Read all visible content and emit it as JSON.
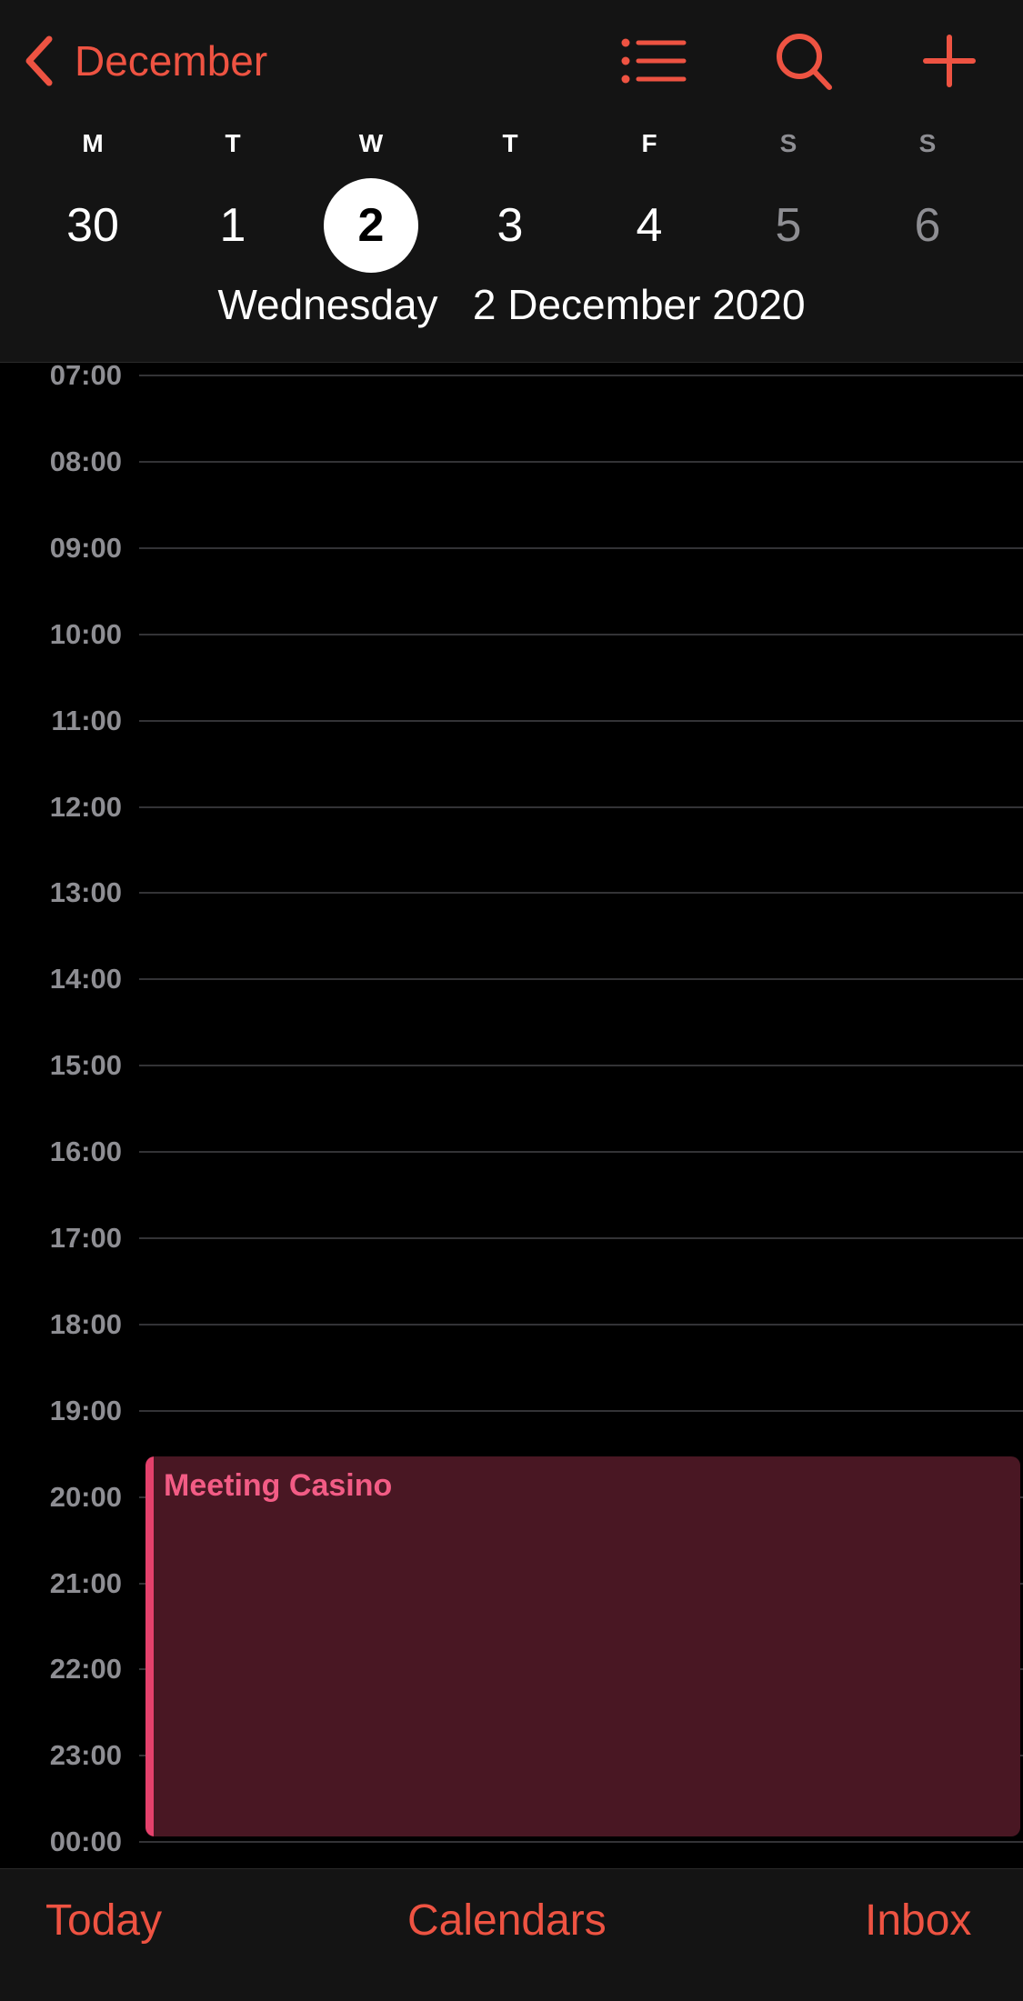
{
  "header": {
    "back_label": "December",
    "icons": {
      "back": "chevron-left-icon",
      "list": "list-icon",
      "search": "search-icon",
      "add": "plus-icon"
    }
  },
  "week": {
    "days": [
      {
        "dow": "M",
        "num": "30"
      },
      {
        "dow": "T",
        "num": "1"
      },
      {
        "dow": "W",
        "num": "2"
      },
      {
        "dow": "T",
        "num": "3"
      },
      {
        "dow": "F",
        "num": "4"
      },
      {
        "dow": "S",
        "num": "5"
      },
      {
        "dow": "S",
        "num": "6"
      }
    ],
    "selected_date": "Wednesday   2 December 2020"
  },
  "timeline": {
    "hours": [
      "07:00",
      "08:00",
      "09:00",
      "10:00",
      "11:00",
      "12:00",
      "13:00",
      "14:00",
      "15:00",
      "16:00",
      "17:00",
      "18:00",
      "19:00",
      "20:00",
      "21:00",
      "22:00",
      "23:00",
      "00:00"
    ]
  },
  "event": {
    "title": "Meeting Casino"
  },
  "toolbar": {
    "today": "Today",
    "calendars": "Calendars",
    "inbox": "Inbox"
  },
  "colors": {
    "accent": "#ee5342",
    "event_background": "#491723",
    "event_bar": "#e5416c",
    "event_text": "#f25c85"
  }
}
